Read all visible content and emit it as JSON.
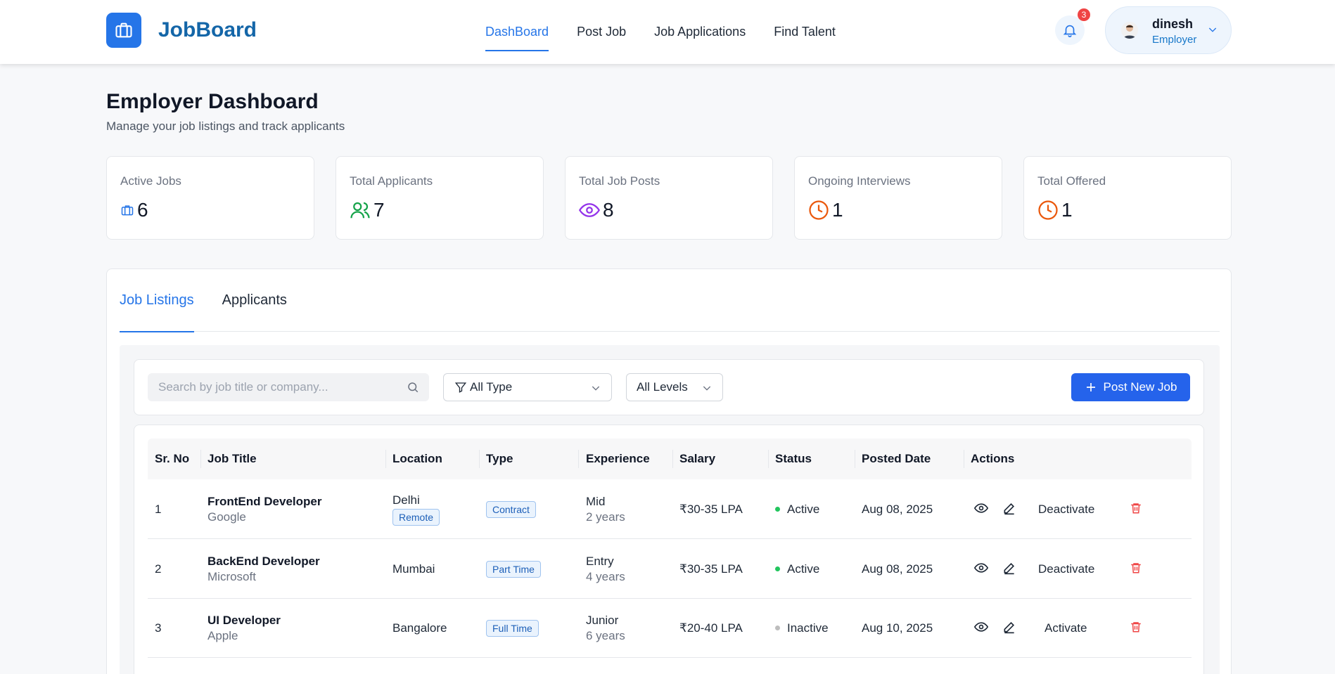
{
  "header": {
    "logo_text": "JobBoard",
    "nav": [
      {
        "label": "DashBoard",
        "active": true
      },
      {
        "label": "Post Job",
        "active": false
      },
      {
        "label": "Job Applications",
        "active": false
      },
      {
        "label": "Find Talent",
        "active": false
      }
    ],
    "notification_count": "3",
    "user": {
      "name": "dinesh",
      "role": "Employer"
    }
  },
  "page": {
    "title": "Employer Dashboard",
    "subtitle": "Manage your job listings and track applicants"
  },
  "stats": [
    {
      "label": "Active Jobs",
      "value": "6",
      "icon": "briefcase-icon",
      "color": "#2575e8"
    },
    {
      "label": "Total Applicants",
      "value": "7",
      "icon": "users-icon",
      "color": "#16a34a"
    },
    {
      "label": "Total Job Posts",
      "value": "8",
      "icon": "eye-icon",
      "color": "#9333ea"
    },
    {
      "label": "Ongoing Interviews",
      "value": "1",
      "icon": "clock-icon",
      "color": "#ea580c"
    },
    {
      "label": "Total Offered",
      "value": "1",
      "icon": "clock-icon",
      "color": "#ea580c"
    }
  ],
  "tabs": [
    {
      "label": "Job Listings",
      "active": true
    },
    {
      "label": "Applicants",
      "active": false
    }
  ],
  "filters": {
    "search_placeholder": "Search by job title or company...",
    "type_select": "All Type",
    "level_select": "All Levels",
    "post_button": "Post New Job"
  },
  "table": {
    "headers": [
      "Sr. No",
      "Job Title",
      "Location",
      "Type",
      "Experience",
      "Salary",
      "Status",
      "Posted Date",
      "Actions"
    ],
    "rows": [
      {
        "sr": "1",
        "title": "FrontEnd Developer",
        "company": "Google",
        "location": "Delhi",
        "location_tag": "Remote",
        "type": "Contract",
        "level": "Mid",
        "years": "2 years",
        "salary": "₹30-35 LPA",
        "status": "Active",
        "posted": "Aug 08, 2025",
        "toggle": "Deactivate"
      },
      {
        "sr": "2",
        "title": "BackEnd Developer",
        "company": "Microsoft",
        "location": "Mumbai",
        "location_tag": "",
        "type": "Part Time",
        "level": "Entry",
        "years": "4 years",
        "salary": "₹30-35 LPA",
        "status": "Active",
        "posted": "Aug 08, 2025",
        "toggle": "Deactivate"
      },
      {
        "sr": "3",
        "title": "UI Developer",
        "company": "Apple",
        "location": "Bangalore",
        "location_tag": "",
        "type": "Full Time",
        "level": "Junior",
        "years": "6 years",
        "salary": "₹20-40 LPA",
        "status": "Inactive",
        "posted": "Aug 10, 2025",
        "toggle": "Activate"
      }
    ]
  },
  "colors": {
    "accent": "#2575e8",
    "active_dot": "#22c55e",
    "inactive_dot": "#bdbdbd",
    "delete": "#ef4444"
  }
}
